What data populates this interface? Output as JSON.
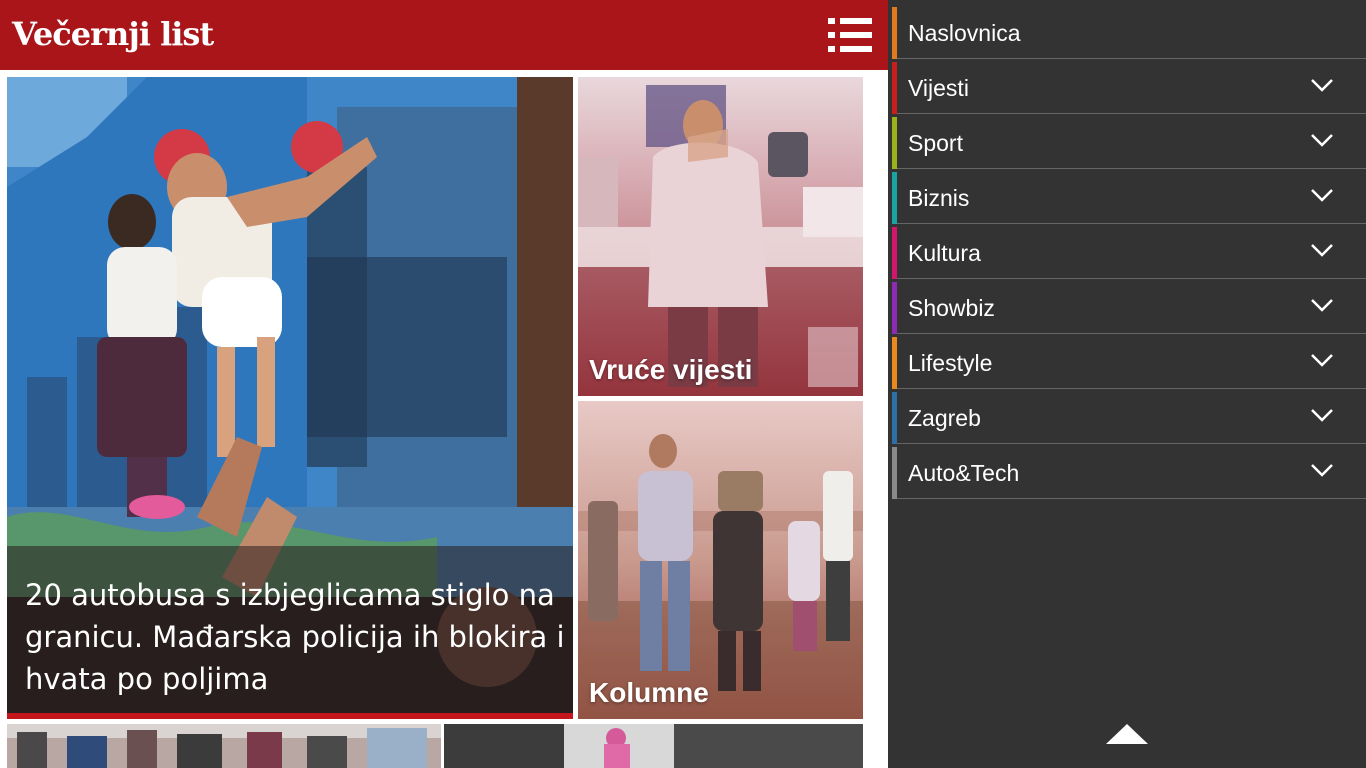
{
  "header": {
    "logo": "Večernji list",
    "menu_icon": "list-menu-icon",
    "background": "#a91519"
  },
  "tiles": {
    "main": {
      "headline": "20 autobusa s izbjeglicama stiglo na granicu. Mađarska policija ih blokira i hvata po poljima",
      "accent": "#c4161c"
    },
    "hot": {
      "label": "Vruće vijesti"
    },
    "columns": {
      "label": "Kolumne"
    }
  },
  "sidebar": {
    "background": "#333333",
    "items": [
      {
        "label": "Naslovnica",
        "color": "#e07a1f",
        "has_dropdown": false
      },
      {
        "label": "Vijesti",
        "color": "#c81e1e",
        "has_dropdown": true
      },
      {
        "label": "Sport",
        "color": "#9bb31b",
        "has_dropdown": true
      },
      {
        "label": "Biznis",
        "color": "#1aa3a3",
        "has_dropdown": true
      },
      {
        "label": "Kultura",
        "color": "#d0176b",
        "has_dropdown": true
      },
      {
        "label": "Showbiz",
        "color": "#8e2ab3",
        "has_dropdown": true
      },
      {
        "label": "Lifestyle",
        "color": "#e88a1e",
        "has_dropdown": true
      },
      {
        "label": "Zagreb",
        "color": "#2f6fa8",
        "has_dropdown": true
      },
      {
        "label": "Auto&Tech",
        "color": "#8a8a8a",
        "has_dropdown": true
      }
    ],
    "scroll_icon": "arrow-up-icon"
  }
}
